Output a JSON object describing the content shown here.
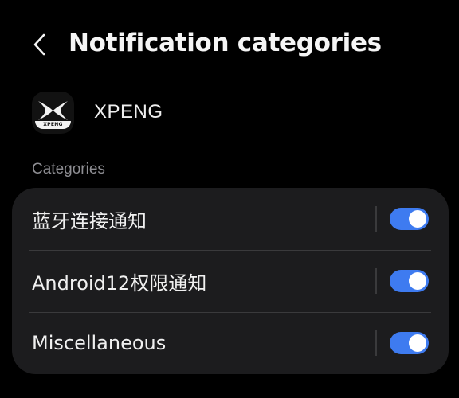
{
  "header": {
    "title": "Notification categories",
    "back_icon": "chevron-left-icon"
  },
  "app": {
    "name": "XPENG",
    "icon_badge_text": "XPENG"
  },
  "section": {
    "label": "Categories"
  },
  "categories": [
    {
      "label": "蓝牙连接通知",
      "enabled": true
    },
    {
      "label": "Android12权限通知",
      "enabled": true
    },
    {
      "label": "Miscellaneous",
      "enabled": true
    }
  ],
  "colors": {
    "background": "#000000",
    "card": "#1c1c1e",
    "toggle_on": "#3e7bf0",
    "secondary_text": "#8e8e93"
  }
}
